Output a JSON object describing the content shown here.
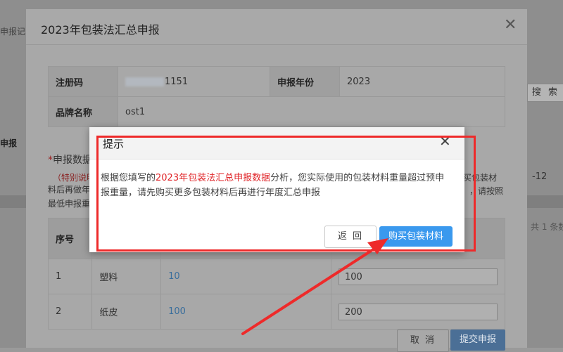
{
  "background": {
    "left_label": "申报记",
    "left_bold": "申报",
    "right_search_button": "搜 索",
    "right_date": "-12",
    "right_page": "共 1 条数"
  },
  "modal": {
    "title": "2023年包装法汇总申报",
    "info": {
      "reg_code_label": "注册码",
      "reg_code_suffix": "1151",
      "year_label": "申报年份",
      "year_value": "2023",
      "brand_label": "品牌名称",
      "brand_value": "ost1"
    },
    "section_title": "申报数据",
    "notice": {
      "line1": "（特别说明",
      "line2": "料后再做年",
      "line3": "最低申报重",
      "right1": "买包装材",
      "right2": "，请按照"
    },
    "table": {
      "headers": [
        "序号",
        "",
        "",
        ""
      ],
      "rows": [
        {
          "index": "1",
          "material": "塑料",
          "prev": "10",
          "weight": "100"
        },
        {
          "index": "2",
          "material": "纸皮",
          "prev": "100",
          "weight": "200"
        }
      ]
    },
    "cancel_label": "取 消",
    "submit_label": "提交申报"
  },
  "dialog": {
    "title": "提示",
    "message_prefix": "根据您填写的",
    "message_highlight": "2023年包装法汇总申报数据",
    "message_suffix": "分析，您实际使用的包装材料重量超过预申报重量，请先购买更多包装材料后再进行年度汇总申报",
    "back_label": "返 回",
    "buy_label": "购买包装材料"
  },
  "colors": {
    "annotation_red": "#ee2a2a",
    "primary_blue": "#3a99ee",
    "highlight_red": "#e0262a"
  }
}
